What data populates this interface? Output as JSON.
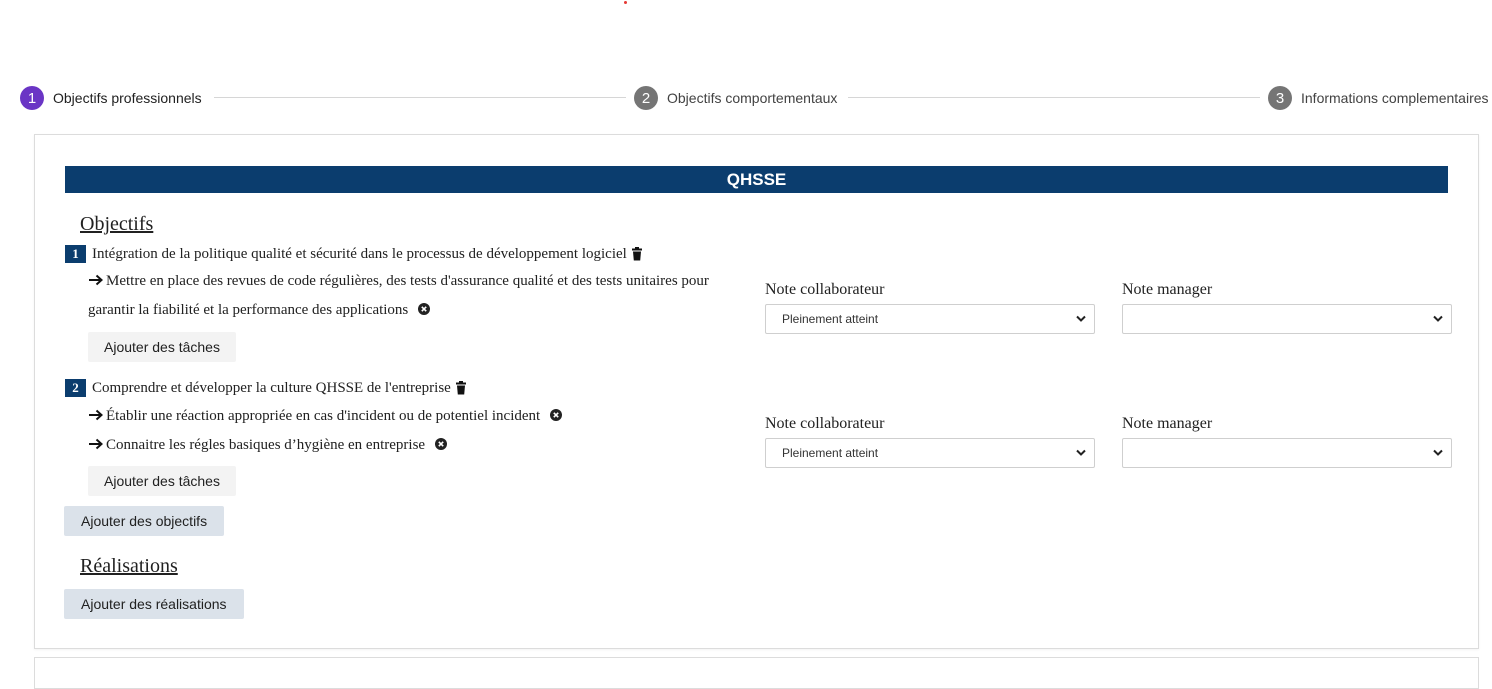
{
  "stepper": {
    "steps": [
      {
        "number": "1",
        "label": "Objectifs professionnels",
        "active": true
      },
      {
        "number": "2",
        "label": "Objectifs comportementaux",
        "active": false
      },
      {
        "number": "3",
        "label": "Informations complementaires",
        "active": false
      }
    ]
  },
  "section": {
    "title": "QHSSE",
    "objectives_heading": "Objectifs",
    "achievements_heading": "Réalisations",
    "add_objectives_label": "Ajouter des objectifs",
    "add_achievements_label": "Ajouter des réalisations"
  },
  "objectives": [
    {
      "number": "1",
      "title": "Intégration de la politique qualité et sécurité dans le processus de développement logiciel",
      "tasks": [
        "Mettre en place des revues de code régulières, des tests d'assurance qualité et des tests unitaires pour garantir la fiabilité et la performance des applications"
      ],
      "add_tasks_label": "Ajouter des tâches",
      "collaborator_label": "Note collaborateur",
      "collaborator_value": "Pleinement atteint",
      "manager_label": "Note manager",
      "manager_value": ""
    },
    {
      "number": "2",
      "title": "Comprendre et développer la culture QHSSE de l'entreprise",
      "tasks": [
        "Établir une réaction appropriée en cas d'incident ou de potentiel incident",
        "Connaitre les régles basiques d’hygiène en entreprise"
      ],
      "add_tasks_label": "Ajouter des tâches",
      "collaborator_label": "Note collaborateur",
      "collaborator_value": "Pleinement atteint",
      "manager_label": "Note manager",
      "manager_value": ""
    }
  ],
  "colors": {
    "accent_step": "#6a35c5",
    "inactive_step": "#757575",
    "header_bar": "#0b3d6e",
    "button_blue": "#dbe2ea",
    "button_grey": "#f3f3f3"
  },
  "icons": {
    "delete": "trash-icon",
    "remove_task": "close-circle-icon",
    "task_bullet": "arrow-right-icon",
    "dropdown": "chevron-down-icon"
  }
}
